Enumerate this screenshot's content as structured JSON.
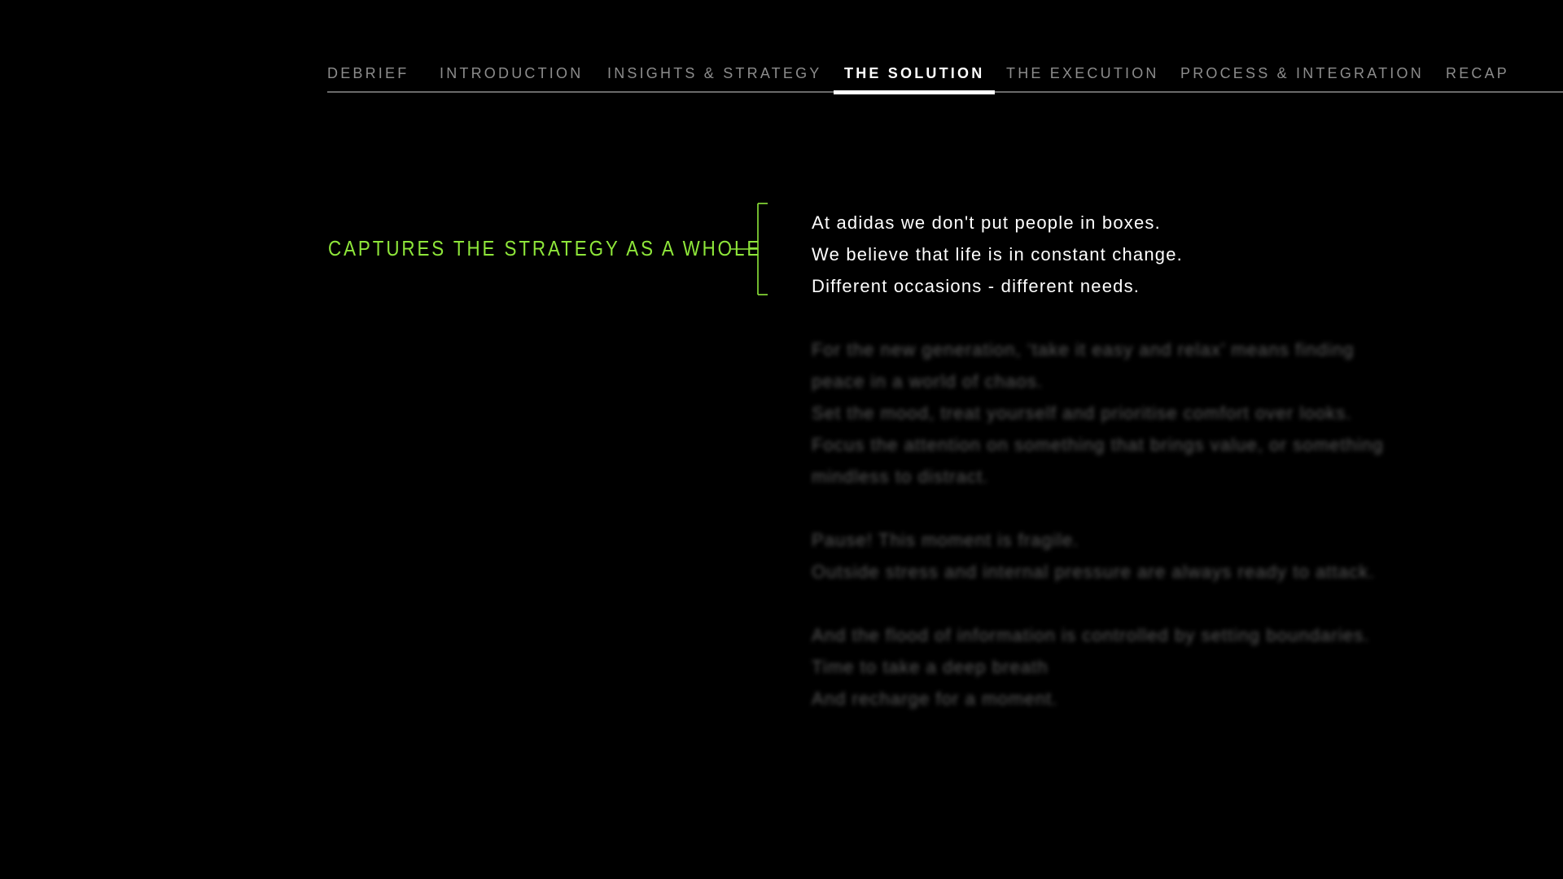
{
  "nav": {
    "tabs": [
      {
        "label": "DEBRIEF",
        "active": false
      },
      {
        "label": "INTRODUCTION",
        "active": false
      },
      {
        "label": "INSIGHTS & STRATEGY",
        "active": false
      },
      {
        "label": "THE SOLUTION",
        "active": true
      },
      {
        "label": "THE EXECUTION",
        "active": false
      },
      {
        "label": "PROCESS & INTEGRATION",
        "active": false
      },
      {
        "label": "RECAP",
        "active": false
      }
    ]
  },
  "callout": {
    "label": "CAPTURES THE STRATEGY AS A WHOLE",
    "accent_color": "#8ee63a"
  },
  "intro_lines": [
    "At adidas we don't put people in boxes.",
    "We believe that life is in constant change.",
    "Different occasions - different needs."
  ],
  "blurred_paragraphs": [
    [
      "For the new generation, ‘take it easy and relax’ means finding",
      "peace in a world of chaos.",
      "Set the mood, treat yourself and prioritise comfort over looks.",
      "Focus the attention on something that brings value, or something",
      "mindless to distract."
    ],
    [
      "Pause! This moment is fragile.",
      "Outside stress and internal pressure are always ready to attack."
    ],
    [
      "And the flood of information is controlled by setting boundaries.",
      "Time to take a deep breath",
      "And recharge for a moment."
    ]
  ]
}
